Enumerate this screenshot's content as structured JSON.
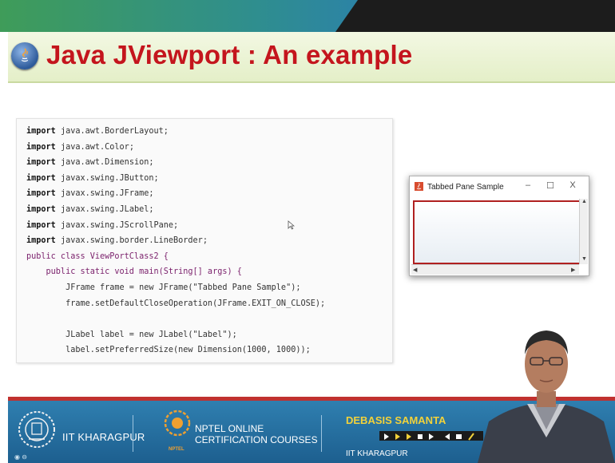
{
  "slide": {
    "title": "Java JViewport : An example"
  },
  "code": {
    "lines": [
      {
        "kw": "import",
        "rest": " java.awt.BorderLayout;"
      },
      {
        "kw": "import",
        "rest": " java.awt.Color;"
      },
      {
        "kw": "import",
        "rest": " java.awt.Dimension;"
      },
      {
        "kw": "import",
        "rest": " javax.swing.JButton;"
      },
      {
        "kw": "import",
        "rest": " javax.swing.JFrame;"
      },
      {
        "kw": "import",
        "rest": " javax.swing.JLabel;"
      },
      {
        "kw": "import",
        "rest": " javax.swing.JScrollPane;"
      },
      {
        "kw": "import",
        "rest": " javax.swing.border.LineBorder;"
      },
      {
        "kw": "",
        "rest": "public class ViewPortClass2 {"
      },
      {
        "kw": "",
        "rest": "    public static void main(String[] args) {"
      },
      {
        "kw": "",
        "rest": "        JFrame frame = new JFrame(\"Tabbed Pane Sample\");"
      },
      {
        "kw": "",
        "rest": "        frame.setDefaultCloseOperation(JFrame.EXIT_ON_CLOSE);"
      },
      {
        "kw": "",
        "rest": ""
      },
      {
        "kw": "",
        "rest": "        JLabel label = new JLabel(\"Label\");"
      },
      {
        "kw": "",
        "rest": "        label.setPreferredSize(new Dimension(1000, 1000));"
      }
    ]
  },
  "window": {
    "title": "Tabbed Pane Sample",
    "minimize": "–",
    "maximize": "☐",
    "close": "X"
  },
  "footer": {
    "institute": "IIT KHARAGPUR",
    "nptel_line1": "NPTEL ONLINE",
    "nptel_line2": "CERTIFICATION COURSES",
    "nptel_small": "NPTEL",
    "speaker_name": "DEBASIS SAMANTA",
    "speaker_institute": "IIT KHARAGPUR"
  },
  "colors": {
    "title": "#c4151d",
    "topbar": "#2f8e8e",
    "footer": "#1d5f8f",
    "footer_accent": "#c0312f",
    "speaker": "#f3d23a"
  },
  "icons": [
    "java-logo-icon",
    "cursor-icon",
    "window-app-icon",
    "iit-logo-icon",
    "nptel-logo-icon"
  ]
}
